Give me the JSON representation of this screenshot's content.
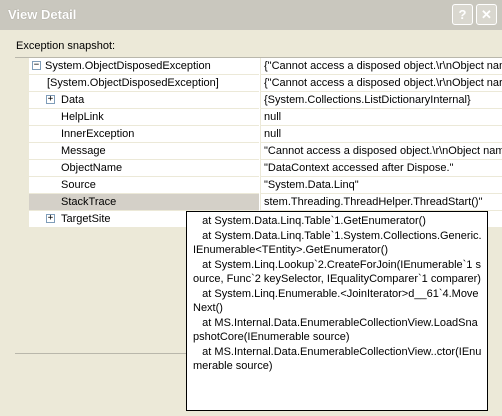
{
  "window": {
    "title": "View Detail",
    "help_glyph": "?",
    "close_glyph": "✕"
  },
  "snapshot_label": "Exception snapshot:",
  "rows": [
    {
      "expander": "−",
      "name": "System.ObjectDisposedException",
      "value": "{\"Cannot access a disposed object.\\r\\nObject nam"
    },
    {
      "expander": "",
      "name": "[System.ObjectDisposedException]",
      "value": "{\"Cannot access a disposed object.\\r\\nObject nar"
    },
    {
      "expander": "+",
      "name": "Data",
      "value": "{System.Collections.ListDictionaryInternal}"
    },
    {
      "expander": "",
      "name": "HelpLink",
      "value": "null"
    },
    {
      "expander": "",
      "name": "InnerException",
      "value": "null"
    },
    {
      "expander": "",
      "name": "Message",
      "value": "\"Cannot access a disposed object.\\r\\nObject nam"
    },
    {
      "expander": "",
      "name": "ObjectName",
      "value": "\"DataContext accessed after Dispose.\""
    },
    {
      "expander": "",
      "name": "Source",
      "value": "\"System.Data.Linq\""
    },
    {
      "expander": "",
      "name": "StackTrace",
      "value": "stem.Threading.ThreadHelper.ThreadStart()\""
    },
    {
      "expander": "+",
      "name": "TargetSite",
      "value": ""
    }
  ],
  "dropdown_glyph": "▼",
  "stacktrace_popup": "   at System.Data.Linq.Table`1.GetEnumerator()\n   at System.Data.Linq.Table`1.System.Collections.Generic.IEnumerable<TEntity>.GetEnumerator()\n   at System.Linq.Lookup`2.CreateForJoin(IEnumerable`1 source, Func`2 keySelector, IEqualityComparer`1 comparer)\n   at System.Linq.Enumerable.<JoinIterator>d__61`4.MoveNext()\n   at MS.Internal.Data.EnumerableCollectionView.LoadSnapshotCore(IEnumerable source)\n   at MS.Internal.Data.EnumerableCollectionView..ctor(IEnumerable source)"
}
